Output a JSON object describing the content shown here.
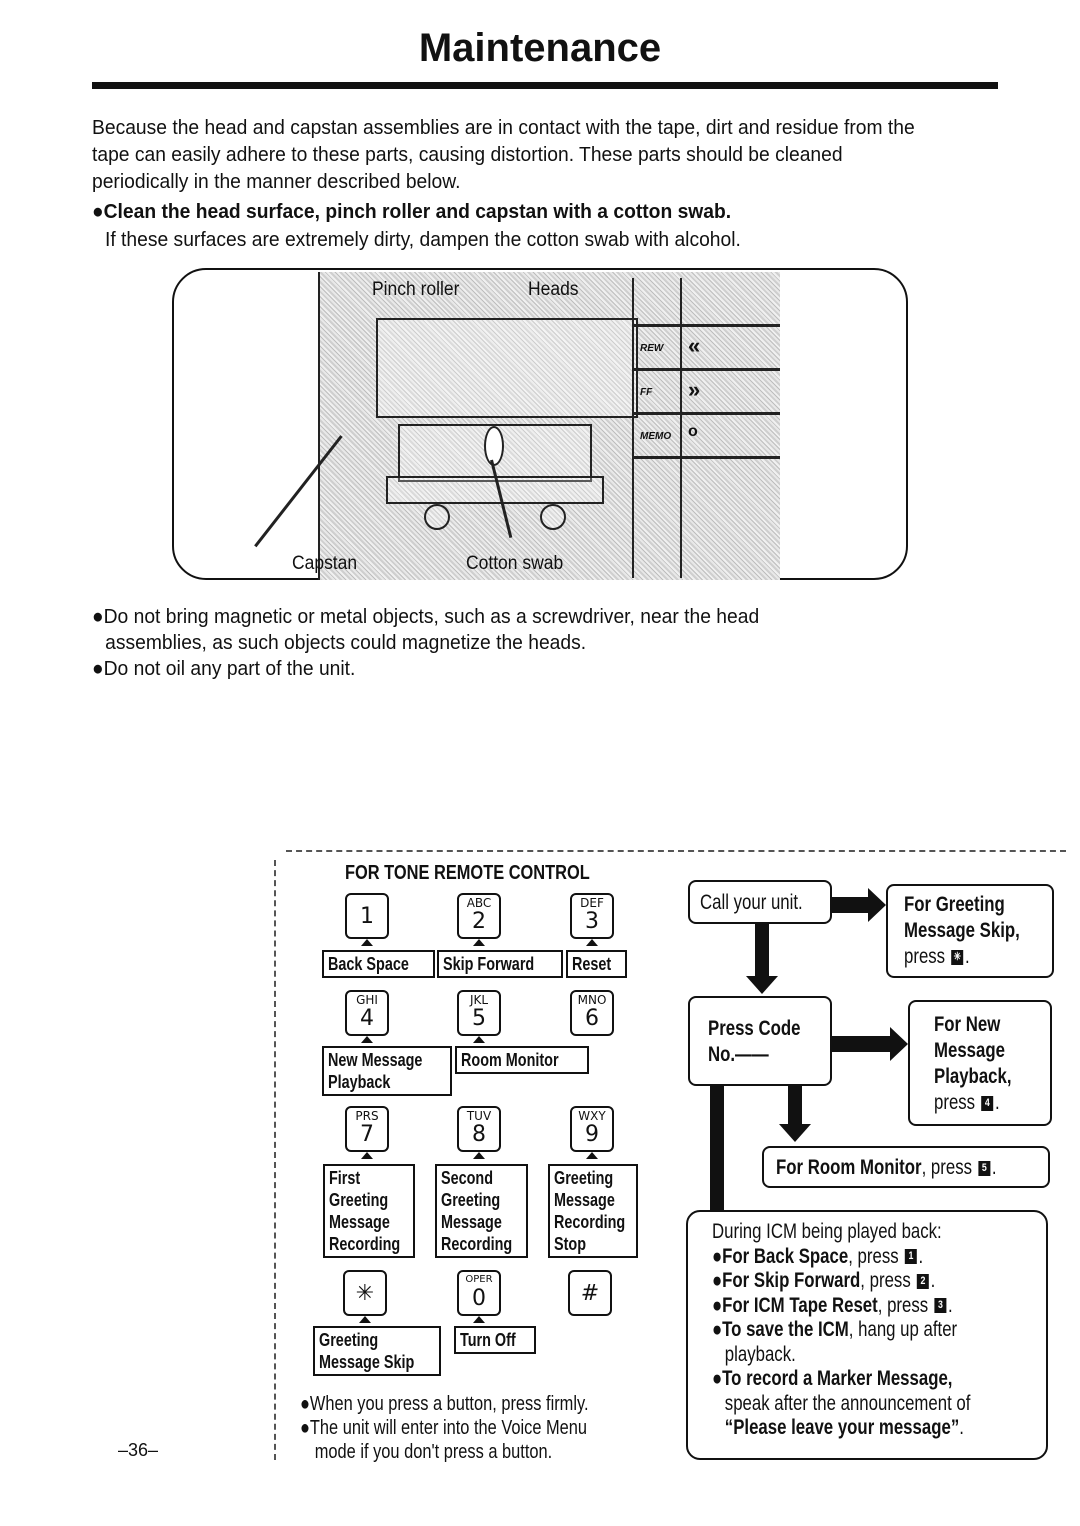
{
  "page": {
    "title": "Maintenance",
    "intro": "Because the head and capstan assemblies are in contact with the tape, dirt and residue from the tape can easily adhere to these parts, causing distortion. These parts should be cleaned periodically in the manner described below.",
    "instruction_bold": "●Clean the head surface, pinch roller and capstan with a cotton swab.",
    "instruction_sub": "If these surfaces are extremely dirty, dampen the cotton swab with alcohol.",
    "figure": {
      "labels": {
        "pinch_roller": "Pinch roller",
        "heads": "Heads",
        "capstan": "Capstan",
        "cotton_swab": "Cotton swab"
      },
      "controls": [
        {
          "tag": "REW",
          "symbol": "«"
        },
        {
          "tag": "FF",
          "symbol": "»"
        },
        {
          "tag": "MEMO",
          "symbol": "o"
        }
      ]
    },
    "cautions": [
      "●Do not bring magnetic or metal objects, such as a screwdriver, near the head",
      "  assemblies, as such objects could magnetize the heads.",
      "●Do not oil any part of the unit."
    ],
    "page_number": "–36–"
  },
  "remote": {
    "title": "FOR TONE REMOTE CONTROL",
    "keys": [
      {
        "letters": "",
        "num": "1",
        "label_lines": [
          "Back Space"
        ]
      },
      {
        "letters": "ABC",
        "num": "2",
        "label_lines": [
          "Skip Forward"
        ]
      },
      {
        "letters": "DEF",
        "num": "3",
        "label_lines": [
          "Reset"
        ]
      },
      {
        "letters": "GHI",
        "num": "4",
        "label_lines": [
          "New Message",
          "Playback"
        ]
      },
      {
        "letters": "JKL",
        "num": "5",
        "label_lines": [
          "Room Monitor"
        ]
      },
      {
        "letters": "MNO",
        "num": "6",
        "label_lines": []
      },
      {
        "letters": "PRS",
        "num": "7",
        "label_lines": [
          "First",
          "Greeting",
          "Message",
          "Recording"
        ]
      },
      {
        "letters": "TUV",
        "num": "8",
        "label_lines": [
          "Second",
          "Greeting",
          "Message",
          "Recording"
        ]
      },
      {
        "letters": "WXY",
        "num": "9",
        "label_lines": [
          "Greeting",
          "Message",
          "Recording",
          "Stop"
        ]
      },
      {
        "letters": "",
        "num": "✳",
        "label_lines": [
          "Greeting",
          "Message Skip"
        ]
      },
      {
        "letters": "OPER",
        "num": "0",
        "label_lines": [
          "Turn Off"
        ]
      },
      {
        "letters": "",
        "num": "#",
        "label_lines": []
      }
    ],
    "notes": [
      "●When you press a button, press firmly.",
      "●The unit will enter into the Voice Menu",
      "  mode if you don't press a button."
    ]
  },
  "flow": {
    "call_unit": "Call your unit.",
    "greeting_skip": {
      "line1": "For Greeting",
      "line2": "Message Skip,",
      "press": "press",
      "key": "✳"
    },
    "press_code": {
      "line1": "Press Code",
      "line2": "No.——"
    },
    "new_message": {
      "line1": "For New",
      "line2": "Message",
      "line3": "Playback,",
      "press": "press",
      "key": "4"
    },
    "room_monitor": {
      "bold": "For Room Monitor",
      "rest": ", press",
      "key": "5"
    },
    "icm": {
      "heading": "During ICM being played back:",
      "items": [
        {
          "bold": "●For Back Space",
          "rest": ", press",
          "key": "1"
        },
        {
          "bold": "●For Skip Forward",
          "rest": ", press",
          "key": "2"
        },
        {
          "bold": "●For ICM Tape Reset",
          "rest": ", press",
          "key": "3"
        }
      ],
      "save_bold": "●To save the ICM",
      "save_rest": ", hang up after",
      "save_rest2": "playback.",
      "marker_bold": "●To record a Marker Message,",
      "marker_rest": "speak after the announcement of",
      "marker_quote": "“Please leave your message”"
    }
  }
}
